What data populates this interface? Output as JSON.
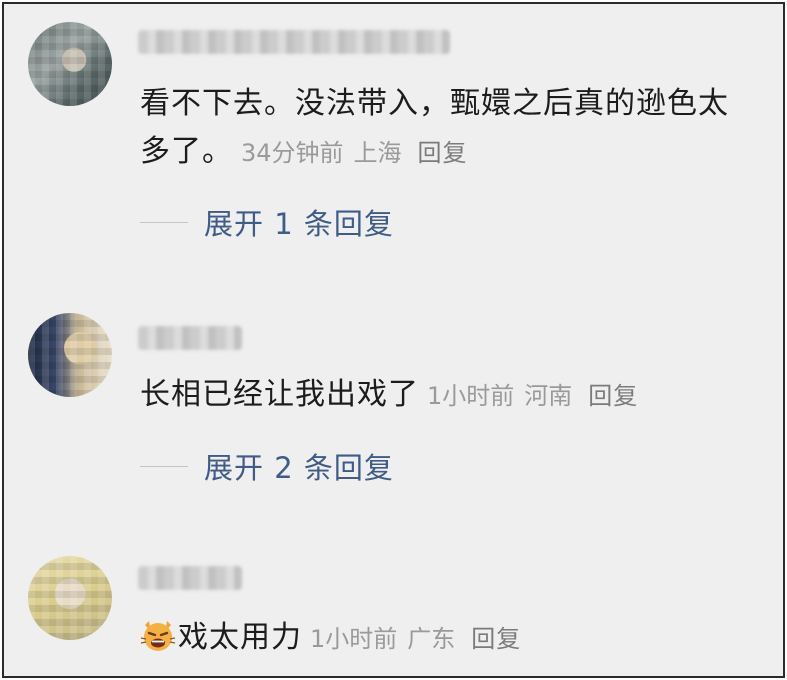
{
  "colors": {
    "background": "#efefef",
    "text": "#1c1c1c",
    "meta": "#9a9a9a",
    "expand_link": "#3f5b87"
  },
  "comments": [
    {
      "avatar_icon": "user-avatar-pixelated",
      "text": "看不下去。没法带入，甄嬛之后真的逊色太多了。",
      "time": "34分钟前",
      "location": "上海",
      "reply_label": "回复",
      "expand_label": "展开 1 条回复"
    },
    {
      "avatar_icon": "user-avatar-pixelated",
      "text": "长相已经让我出戏了",
      "time": "1小时前",
      "location": "河南",
      "reply_label": "回复",
      "expand_label": "展开 2 条回复"
    },
    {
      "avatar_icon": "user-avatar-pixelated",
      "emoji": "angry-cat-emoji",
      "text": "戏太用力",
      "time": "1小时前",
      "location": "广东",
      "reply_label": "回复"
    }
  ]
}
